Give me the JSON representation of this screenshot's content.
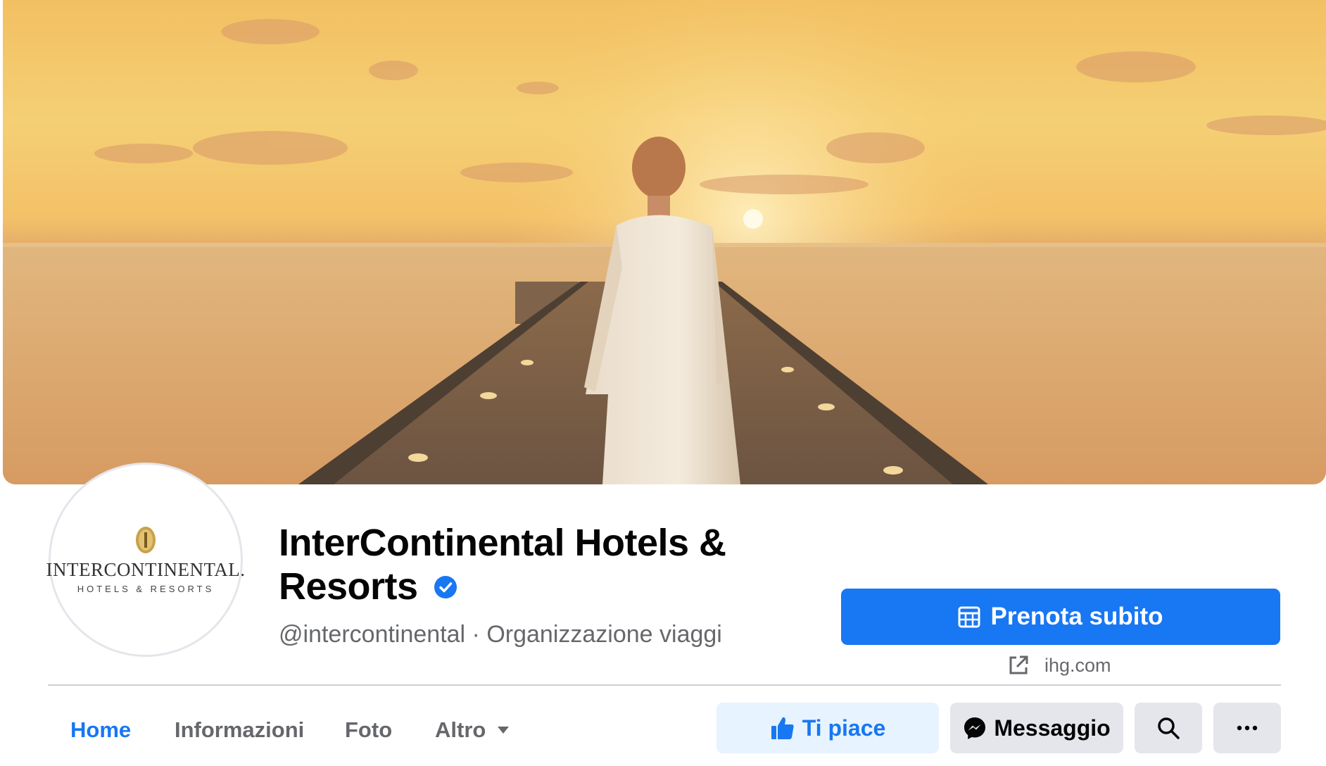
{
  "page": {
    "name": "InterContinental Hotels & Resorts",
    "verified": true,
    "handle": "@intercontinental",
    "separator": "·",
    "category": "Organizzazione viaggi",
    "subtitle": "@intercontinental · Organizzazione viaggi"
  },
  "avatar": {
    "brand": "INTERCONTINENTAL.",
    "brand_sub": "HOTELS & RESORTS",
    "emblem_icon": "intercontinental-emblem"
  },
  "cta": {
    "label": "Prenota subito",
    "icon": "calendar-icon",
    "website": "ihg.com",
    "website_icon": "external-link-icon"
  },
  "tabs": [
    {
      "label": "Home",
      "active": true
    },
    {
      "label": "Informazioni",
      "active": false
    },
    {
      "label": "Foto",
      "active": false
    },
    {
      "label": "Altro",
      "active": false,
      "icon": "caret-down-icon"
    }
  ],
  "actions": {
    "like_label": "Ti piace",
    "like_icon": "thumbs-up-icon",
    "message_label": "Messaggio",
    "message_icon": "messenger-icon",
    "search_icon": "search-icon",
    "more_icon": "more-icon"
  },
  "colors": {
    "brand_blue": "#1877f2",
    "light_blue_bg": "#e7f3ff",
    "button_grey": "#e4e6eb",
    "secondary_text": "#65676b"
  }
}
